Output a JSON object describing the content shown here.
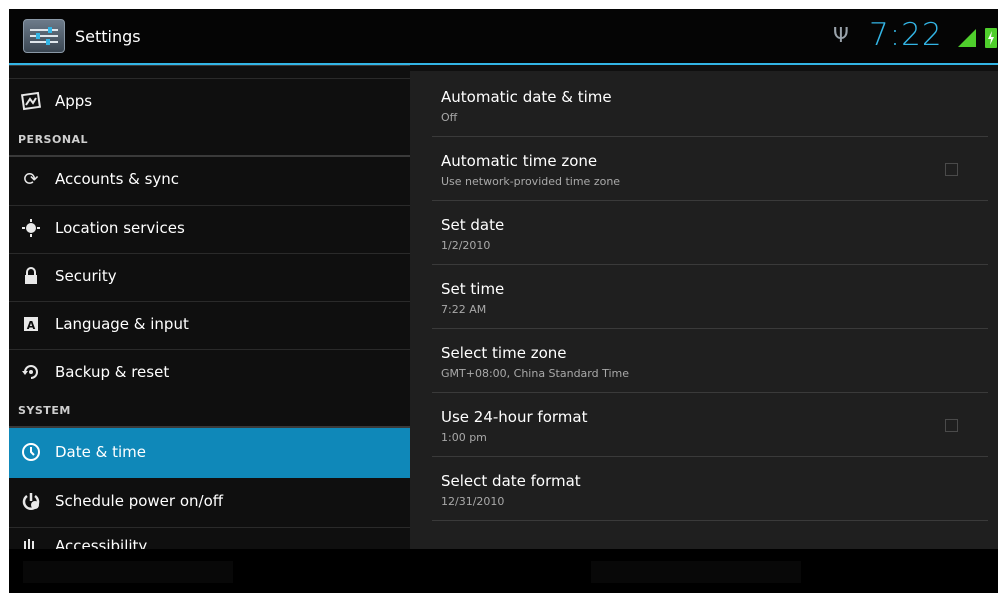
{
  "status_bar": {
    "app_title": "Settings",
    "app_icon": "settings-sliders-icon",
    "time": "7:22",
    "accent_color": "#33b5e5",
    "icons": [
      "usb-icon",
      "signal-icon",
      "battery-charging-icon"
    ]
  },
  "sidebar": {
    "items": [
      {
        "label": "Apps",
        "icon": "apps-icon"
      },
      {
        "label": "Accounts & sync",
        "icon": "sync-icon"
      },
      {
        "label": "Location services",
        "icon": "location-icon"
      },
      {
        "label": "Security",
        "icon": "lock-icon"
      },
      {
        "label": "Language & input",
        "icon": "language-icon"
      },
      {
        "label": "Backup & reset",
        "icon": "backup-icon"
      },
      {
        "label": "Date & time",
        "icon": "clock-icon",
        "selected": true
      },
      {
        "label": "Schedule power on/off",
        "icon": "power-schedule-icon"
      },
      {
        "label": "Accessibility",
        "icon": "accessibility-icon"
      }
    ],
    "sections": {
      "personal": "PERSONAL",
      "system": "SYSTEM"
    },
    "selected_color": "#0f88b9"
  },
  "detail": {
    "prefs": [
      {
        "title": "Automatic date & time",
        "summary": "Off"
      },
      {
        "title": "Automatic time zone",
        "summary": "Use network-provided time zone",
        "checked": false
      },
      {
        "title": "Set date",
        "summary": "1/2/2010"
      },
      {
        "title": "Set time",
        "summary": "7:22 AM"
      },
      {
        "title": "Select time zone",
        "summary": "GMT+08:00, China Standard Time"
      },
      {
        "title": "Use 24-hour format",
        "summary": "1:00 pm",
        "checked": false
      },
      {
        "title": "Select date format",
        "summary": "12/31/2010"
      }
    ]
  }
}
